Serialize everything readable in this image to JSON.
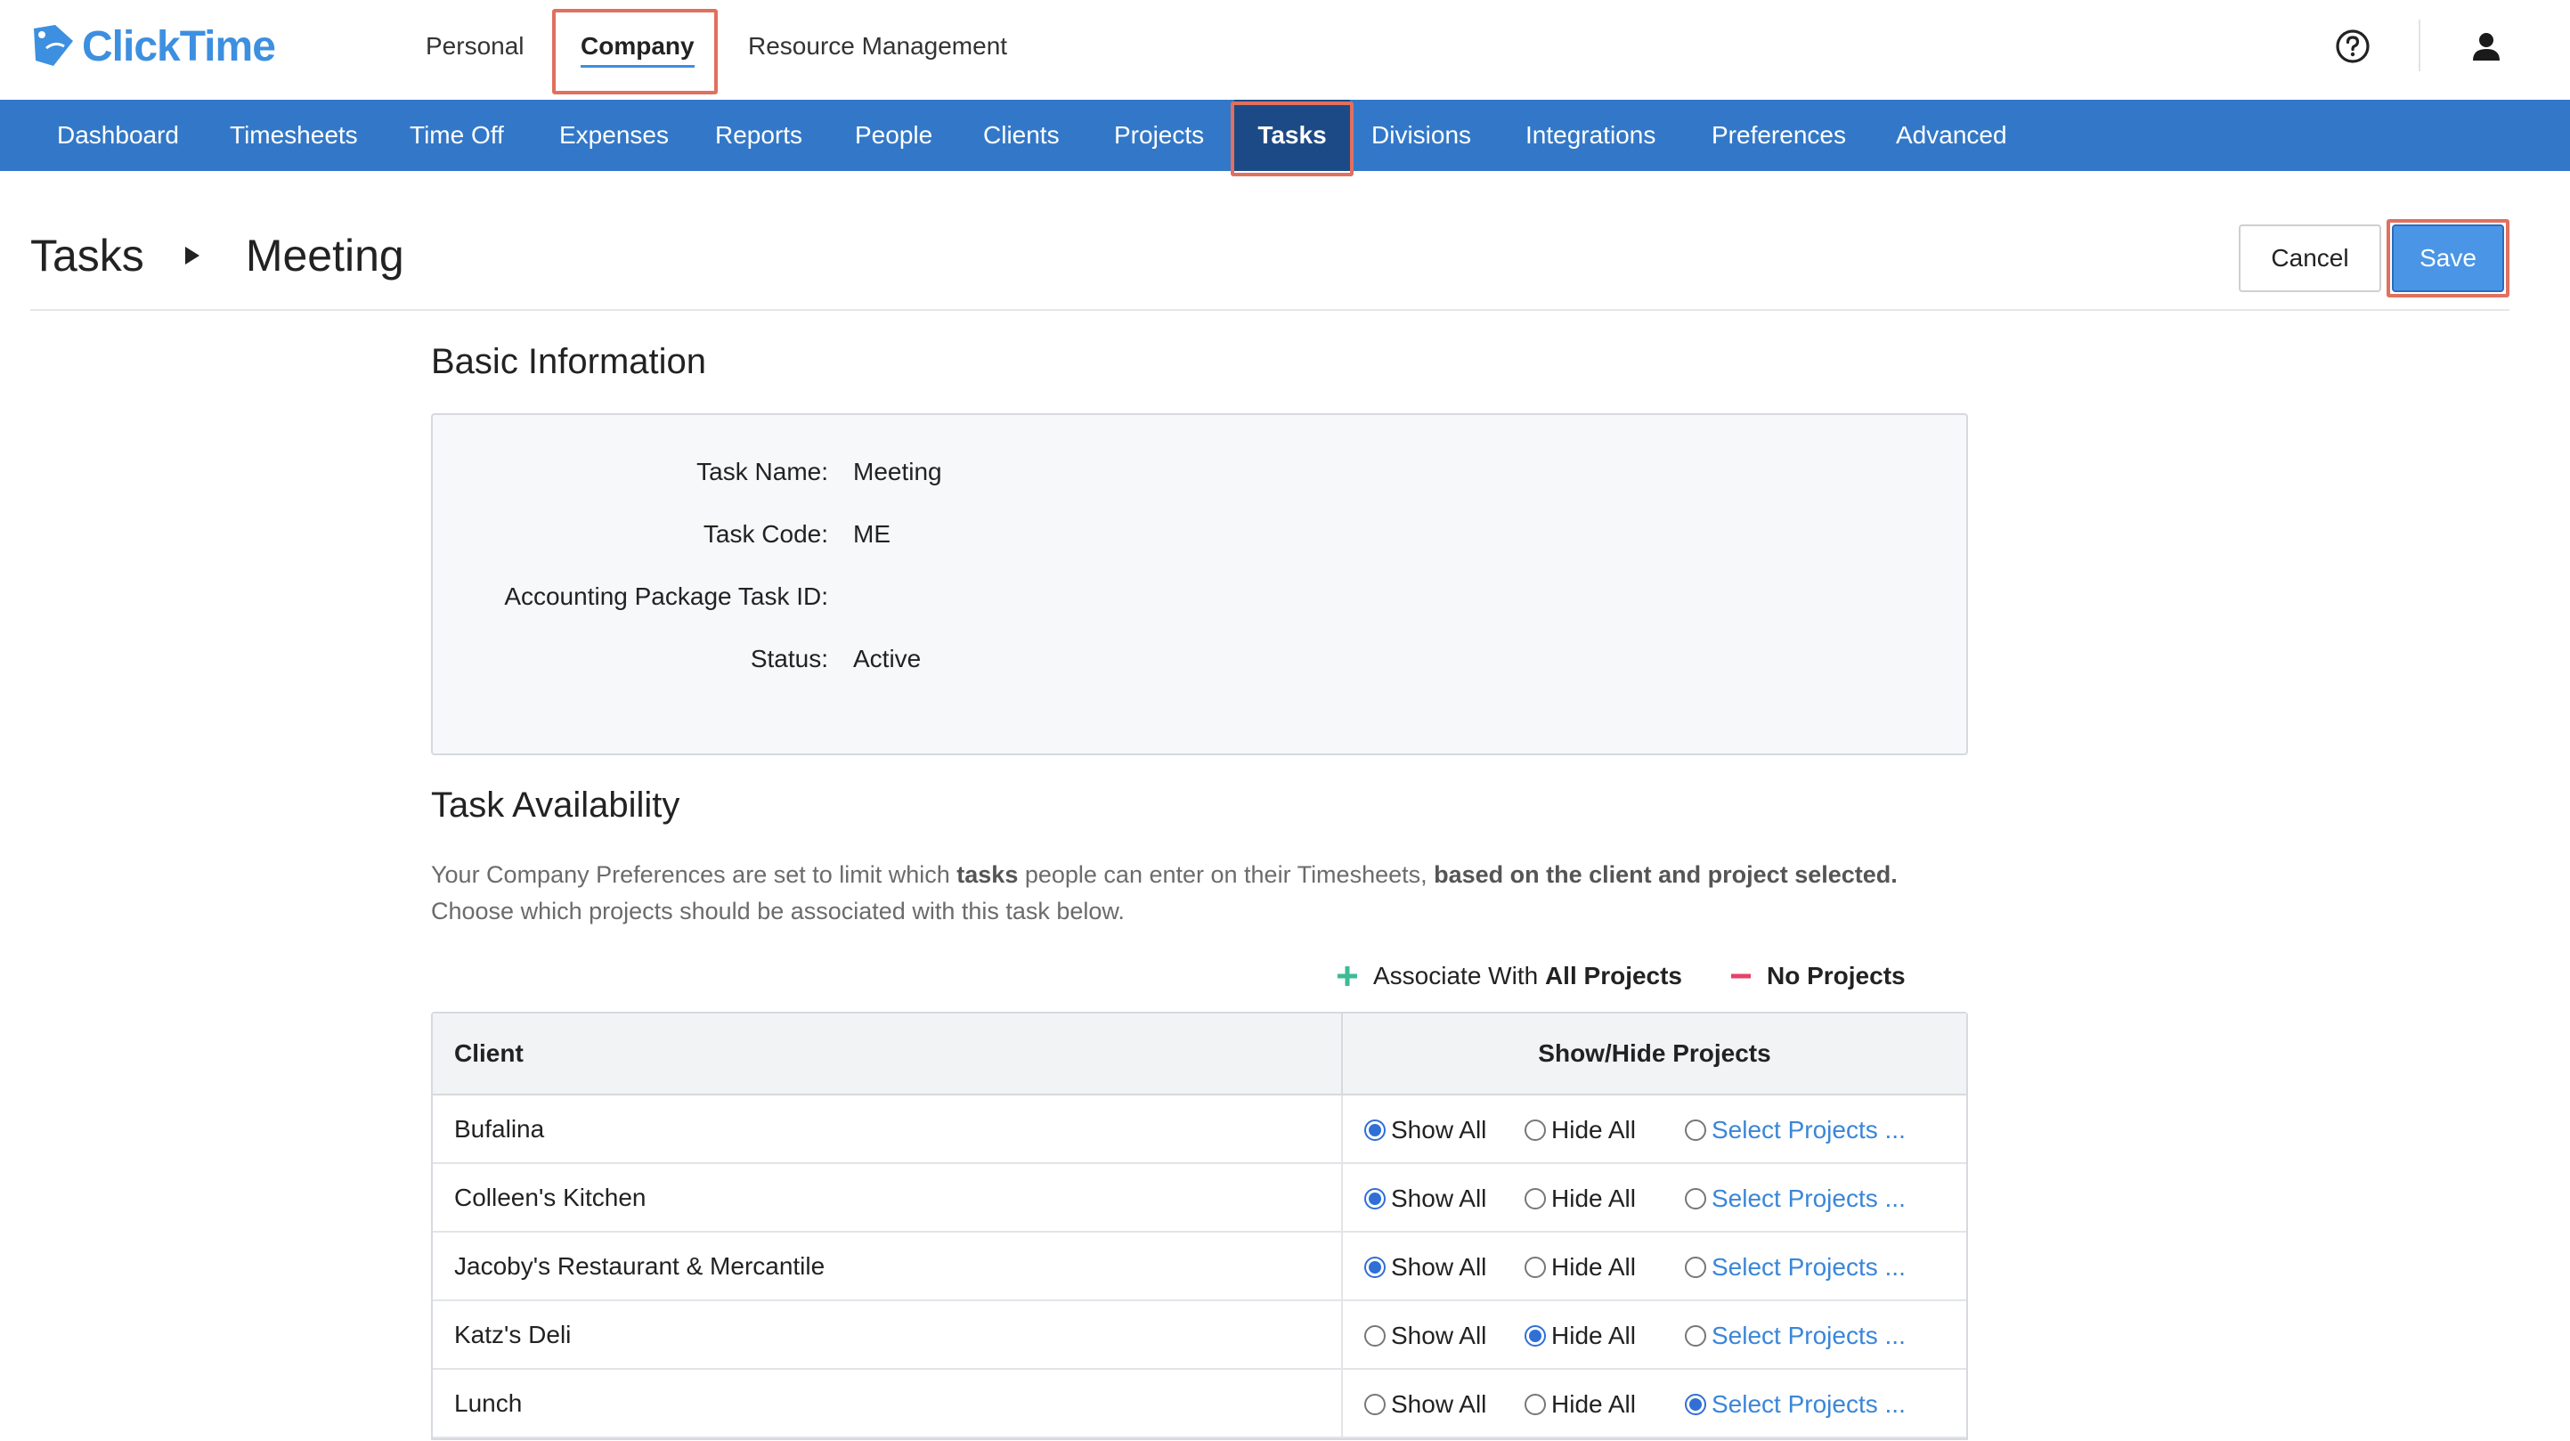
{
  "brand": {
    "name": "ClickTime",
    "color": "#3d8fe0"
  },
  "top_nav": [
    {
      "label": "Personal",
      "active": false
    },
    {
      "label": "Company",
      "active": true
    },
    {
      "label": "Resource Management",
      "active": false
    }
  ],
  "top_icons": {
    "help": "help-circle-icon",
    "user": "user-icon"
  },
  "main_nav": [
    {
      "label": "Dashboard",
      "active": false
    },
    {
      "label": "Timesheets",
      "active": false
    },
    {
      "label": "Time Off",
      "active": false
    },
    {
      "label": "Expenses",
      "active": false
    },
    {
      "label": "Reports",
      "active": false
    },
    {
      "label": "People",
      "active": false
    },
    {
      "label": "Clients",
      "active": false
    },
    {
      "label": "Projects",
      "active": false
    },
    {
      "label": "Tasks",
      "active": true
    },
    {
      "label": "Divisions",
      "active": false
    },
    {
      "label": "Integrations",
      "active": false
    },
    {
      "label": "Preferences",
      "active": false
    },
    {
      "label": "Advanced",
      "active": false
    }
  ],
  "header": {
    "breadcrumb_root": "Tasks",
    "breadcrumb_current": "Meeting",
    "cancel_label": "Cancel",
    "save_label": "Save"
  },
  "basic_info": {
    "title": "Basic Information",
    "fields": [
      {
        "label": "Task Name:",
        "value": "Meeting"
      },
      {
        "label": "Task Code:",
        "value": "ME"
      },
      {
        "label": "Accounting Package Task ID:",
        "value": ""
      },
      {
        "label": "Status:",
        "value": "Active"
      }
    ]
  },
  "availability": {
    "title": "Task Availability",
    "desc_1": "Your Company Preferences are set to limit which ",
    "desc_bold_1": "tasks",
    "desc_2": " people can enter on their Timesheets, ",
    "desc_bold_2": "based on the client and project selected.",
    "desc_3": "Choose which projects should be associated with this task below.",
    "associate_prefix": "Associate With ",
    "associate_bold": "All Projects",
    "no_projects": "No Projects"
  },
  "table": {
    "col_client": "Client",
    "col_show": "Show/Hide Projects",
    "option_labels": {
      "show": "Show All",
      "hide": "Hide All",
      "select": "Select Projects ..."
    },
    "rows": [
      {
        "client": "Bufalina",
        "selected": "show"
      },
      {
        "client": "Colleen's Kitchen",
        "selected": "show"
      },
      {
        "client": "Jacoby's Restaurant & Mercantile",
        "selected": "show"
      },
      {
        "client": "Katz's Deli",
        "selected": "hide"
      },
      {
        "client": "Lunch",
        "selected": "select"
      }
    ]
  },
  "colors": {
    "nav_bg": "#3378c8",
    "nav_active": "#1c4a86",
    "save_bg": "#4a95e6",
    "highlight": "#e0705f",
    "link": "#3a86d8",
    "plus_icon": "#3dbb94",
    "minus_icon": "#e8416a"
  }
}
